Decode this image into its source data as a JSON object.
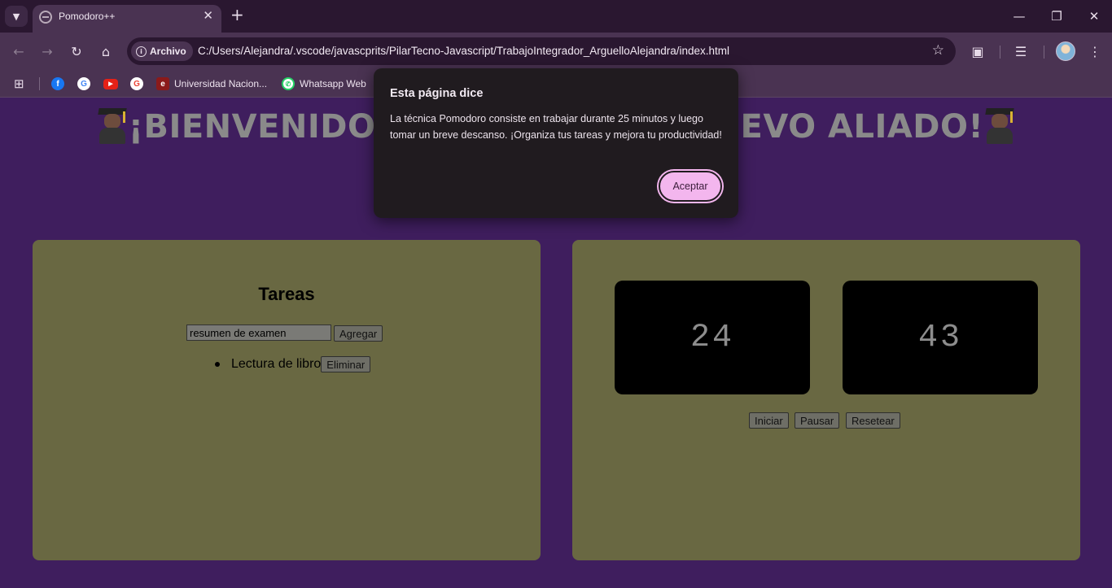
{
  "browser": {
    "tab_title": "Pomodoro++",
    "address_chip": "Archivo",
    "url": "C:/Users/Alejandra/.vscode/javascprits/PilarTecno-Javascript/TrabajoIntegrador_ArguelloAlejandra/index.html",
    "bookmarks": [
      {
        "label": "",
        "icon": "facebook-icon"
      },
      {
        "label": "",
        "icon": "google-icon"
      },
      {
        "label": "",
        "icon": "youtube-icon"
      },
      {
        "label": "",
        "icon": "google-icon"
      },
      {
        "label": "Universidad Nacion...",
        "icon": "university-icon"
      },
      {
        "label": "Whatsapp Web",
        "icon": "whatsapp-icon"
      }
    ]
  },
  "page": {
    "headline_left": "¡BIENVENIDO",
    "headline_right": "EVO ALIADO!",
    "tasks": {
      "title": "Tareas",
      "input_value": "resumen de examen",
      "add_label": "Agregar",
      "items": [
        {
          "text": "Lectura de libro",
          "delete_label": "Eliminar"
        }
      ]
    },
    "timer": {
      "minutes": "24",
      "seconds": "43",
      "start_label": "Iniciar",
      "pause_label": "Pausar",
      "reset_label": "Resetear"
    }
  },
  "dialog": {
    "title": "Esta página dice",
    "message": "La técnica Pomodoro consiste en trabajar durante 25 minutos y luego tomar un breve descanso. ¡Organiza tus tareas y mejora tu productividad!",
    "ok_label": "Aceptar"
  },
  "colors": {
    "page_background": "#3f1e5e",
    "panel": "#696842",
    "dialog_background": "#201b1f",
    "dialog_accent": "#f3b6ee"
  }
}
